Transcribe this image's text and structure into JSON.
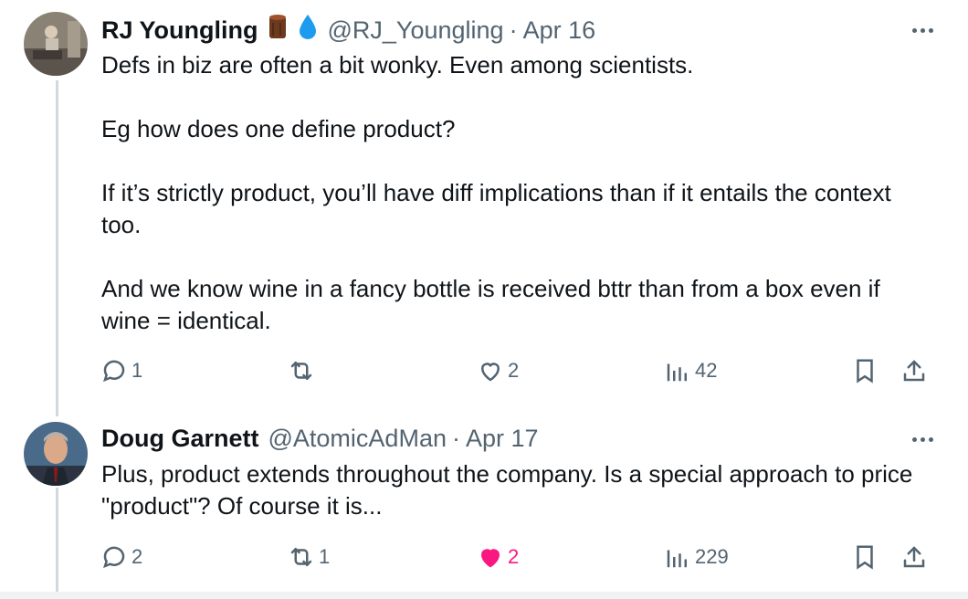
{
  "tweets": [
    {
      "name": "RJ Youngling",
      "handle": "@RJ_Youngling",
      "separator": "·",
      "date": "Apr 16",
      "text": "Defs in biz are often a bit wonky. Even among scientists.\n\nEg how does one define product?\n\nIf it’s strictly product, you’ll have diff implications than if it entails the context too.\n\nAnd we know wine in a fancy bottle is received bttr than from a box even if wine = identical.",
      "replies": "1",
      "reposts": "",
      "likes": "2",
      "views": "42",
      "liked": false
    },
    {
      "name": "Doug Garnett",
      "handle": "@AtomicAdMan",
      "separator": "·",
      "date": "Apr 17",
      "text": "Plus, product extends throughout the company. Is a special approach to price \"product\"? Of course it is...",
      "replies": "2",
      "reposts": "1",
      "likes": "2",
      "views": "229",
      "liked": true
    }
  ],
  "colors": {
    "text": "#0f1419",
    "secondary": "#536471",
    "like_active": "#f91880",
    "verified_drop": "#1d9bf0"
  }
}
